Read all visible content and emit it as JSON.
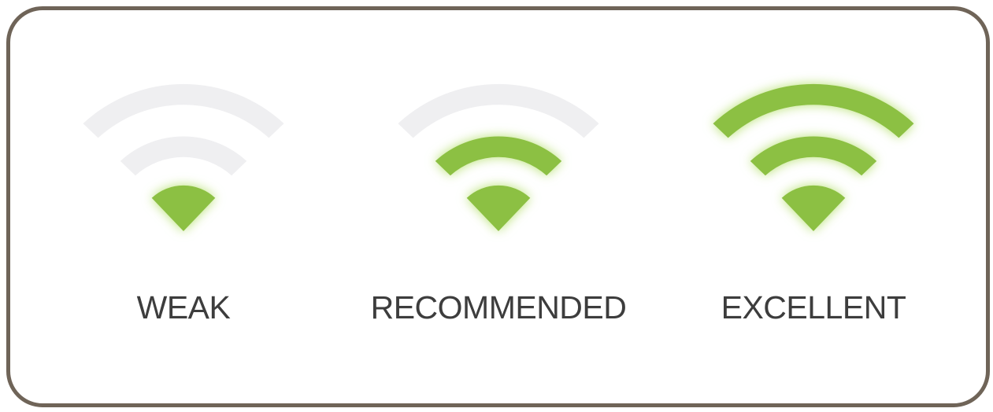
{
  "colors": {
    "border": "#6f6458",
    "active": "#8cc043",
    "inactive": "#efeff1",
    "text": "#3d3d3d"
  },
  "levels": [
    {
      "label": "WEAK",
      "active_bars": 1
    },
    {
      "label": "RECOMMENDED",
      "active_bars": 2
    },
    {
      "label": "EXCELLENT",
      "active_bars": 3
    }
  ]
}
